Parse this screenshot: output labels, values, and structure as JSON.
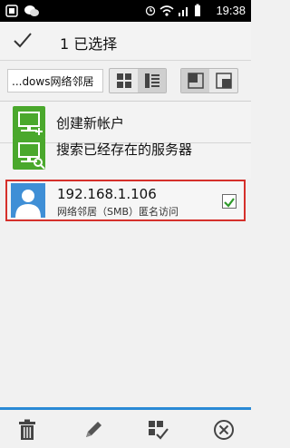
{
  "status_bar": {
    "time": "19:38"
  },
  "header": {
    "selection_text": "1 已选择"
  },
  "toolbar": {
    "path": "...dows网络邻居"
  },
  "list": [
    {
      "title": "创建新帐户",
      "icon": "network-add-icon"
    },
    {
      "title": "搜索已经存在的服务器",
      "icon": "network-search-icon"
    }
  ],
  "selected_item": {
    "ip": "192.168.1.106",
    "subtitle": "网络邻居（SMB）匿名访问",
    "checked": true
  },
  "bottom_bar": {
    "icons": [
      "trash-icon",
      "pencil-icon",
      "select-all-icon",
      "close-circle-icon"
    ]
  },
  "colors": {
    "accent_blue": "#2a8ad6",
    "green": "#4aa82c",
    "highlight_red": "#d5302b"
  }
}
